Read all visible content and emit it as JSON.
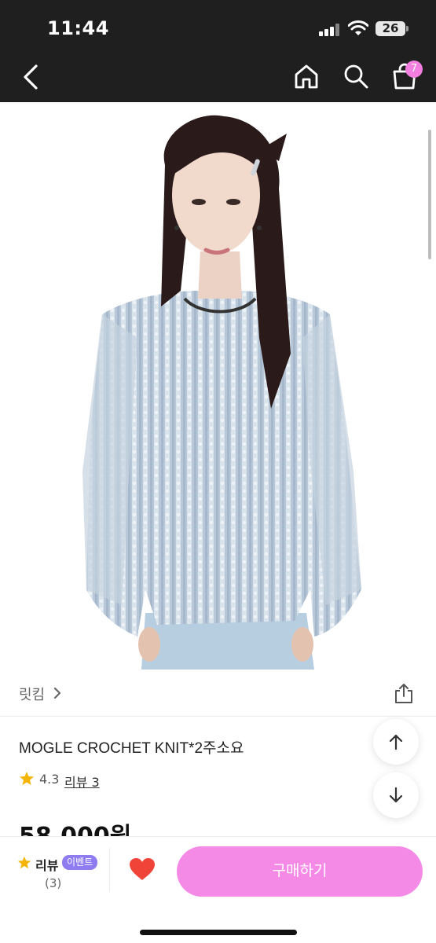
{
  "status_bar": {
    "time": "11:44",
    "battery": "26"
  },
  "nav": {
    "cart_count": "7"
  },
  "store": {
    "name": "릿킴"
  },
  "product": {
    "title": "MOGLE CROCHET KNIT*2주소요",
    "rating": "4.3",
    "review_link": "리뷰 3",
    "price_peek": "58,000원"
  },
  "bottom_bar": {
    "review_label": "리뷰",
    "event_badge": "이벤트",
    "review_count": "(3)",
    "buy_label": "구매하기"
  },
  "colors": {
    "accent_pink": "#f58ae6",
    "badge_purple": "#8e7cf0",
    "heart_red": "#f04438",
    "star_gold": "#f4b400"
  },
  "icons": [
    "back-icon",
    "home-icon",
    "search-icon",
    "shopping-bag-icon",
    "share-icon",
    "chevron-right-icon",
    "star-icon",
    "arrow-up-icon",
    "arrow-down-icon",
    "heart-icon"
  ]
}
